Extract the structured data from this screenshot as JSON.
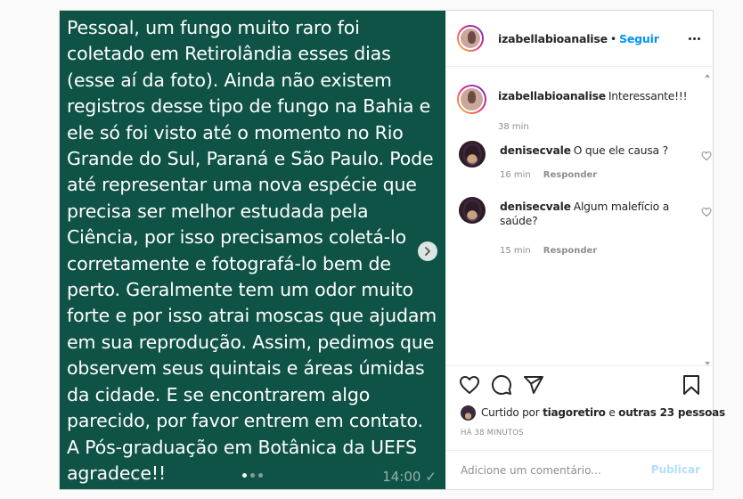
{
  "post": {
    "message": "Pessoal, um fungo muito raro foi coletado em Retirolândia esses dias (esse aí da foto). Ainda não existem registros desse tipo de fungo na Bahia e ele só foi visto até o momento no Rio Grande do Sul, Paraná e São Paulo. Pode até representar uma nova espécie que precisa ser melhor estudada pela Ciência, por isso precisamos coletá-lo corretamente e fotografá-lo bem de perto. Geralmente tem um odor muito forte e por isso atrai moscas que ajudam em sua reprodução. Assim, pedimos que observem seus quintais e áreas úmidas da cidade. E se encontrarem algo parecido, por favor entrem em contato. A Pós-graduação em Botânica da UEFS agradece!!",
    "message_time": "14:00",
    "carousel_dots": 3,
    "active_dot": 0,
    "media_bg": "#0f5346"
  },
  "header": {
    "username": "izabellabioanalise",
    "separator": "•",
    "follow_label": "Seguir"
  },
  "caption": {
    "username": "izabellabioanalise",
    "text": "Interessante!!!",
    "time": "38 min"
  },
  "comments": [
    {
      "username": "denisecvale",
      "text": "O que ele causa ?",
      "time": "16 min",
      "reply_label": "Responder"
    },
    {
      "username": "denisecvale",
      "text": "Algum malefício a saúde?",
      "time": "15 min",
      "reply_label": "Responder"
    }
  ],
  "likes": {
    "prefix": "Curtido por",
    "user": "tiagoretiro",
    "conjunction": "e",
    "others": "outras 23 pessoas"
  },
  "time_ago": "HÁ 38 MINUTOS",
  "add_comment": {
    "placeholder": "Adicione um comentário...",
    "publish_label": "Publicar"
  },
  "colors": {
    "accent": "#0095f6",
    "publish_disabled": "#b2dffc"
  }
}
